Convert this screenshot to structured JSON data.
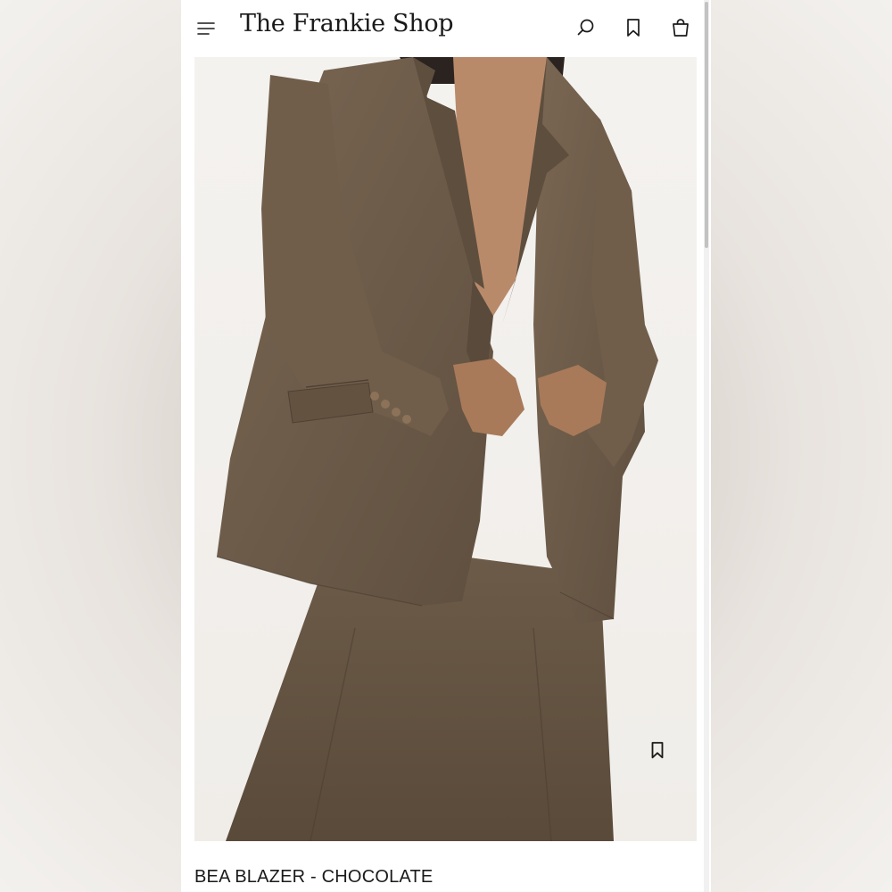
{
  "header": {
    "brand": "The Frankie Shop",
    "icons": [
      "menu-icon",
      "search-icon",
      "bookmark-icon",
      "bag-icon"
    ]
  },
  "product": {
    "title": "BEA BLAZER - CHOCOLATE",
    "image_icon": "product-image",
    "wishlist_icon": "bookmark-icon"
  },
  "colors": {
    "background": "#ffffff",
    "text": "#1a1a1a",
    "suit": "#6b5a48"
  }
}
